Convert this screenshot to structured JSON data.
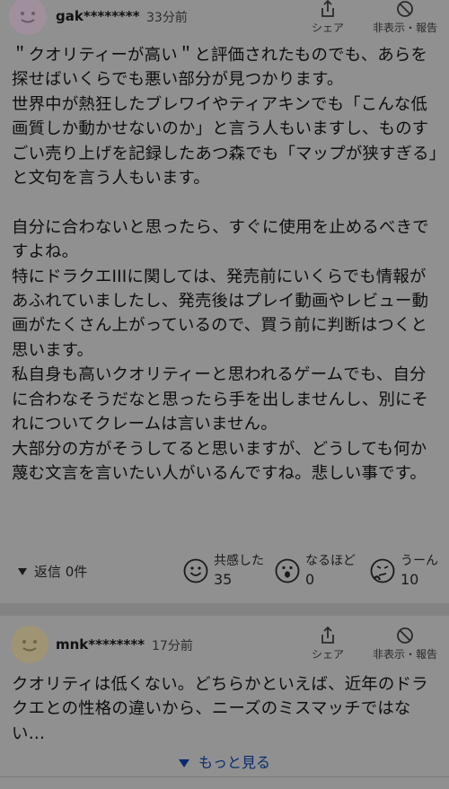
{
  "comments": [
    {
      "username": "gak********",
      "time": "33分前",
      "share_label": "シェア",
      "report_label": "非表示・報告",
      "body": "＂クオリティーが高い＂と評価されたものでも、あらを探せばいくらでも悪い部分が見つかります。\n世界中が熱狂したブレワイやティアキンでも「こんな低画質しか動かせないのか」と言う人もいますし、ものすごい売り上げを記録したあつ森でも「マップが狭すぎる」と文句を言う人もいます。\n\n自分に合わないと思ったら、すぐに使用を止めるべきですよね。\n特にドラクエIIIに関しては、発売前にいくらでも情報があふれていましたし、発売後はプレイ動画やレビュー動画がたくさん上がっているので、買う前に判断はつくと思います。\n私自身も高いクオリティーと思われるゲームでも、自分に合わなそうだなと思ったら手を出しませんし、別にそれについてクレームは言いません。\n大部分の方がそうしてると思いますが、どうしても何か蔑む文言を言いたい人がいるんですね。悲しい事です。",
      "reply_label": "返信 0件",
      "reactions": [
        {
          "label": "共感した",
          "count": "35",
          "icon": "smile-icon"
        },
        {
          "label": "なるほど",
          "count": "0",
          "icon": "surprised-icon"
        },
        {
          "label": "うーん",
          "count": "10",
          "icon": "thinking-icon"
        }
      ]
    },
    {
      "username": "mnk********",
      "time": "17分前",
      "share_label": "シェア",
      "report_label": "非表示・報告",
      "body": "クオリティは低くない。どちらかといえば、近年のドラクエとの性格の違いから、ニーズのミスマッチではない…"
    }
  ],
  "more_label": "もっと見る"
}
